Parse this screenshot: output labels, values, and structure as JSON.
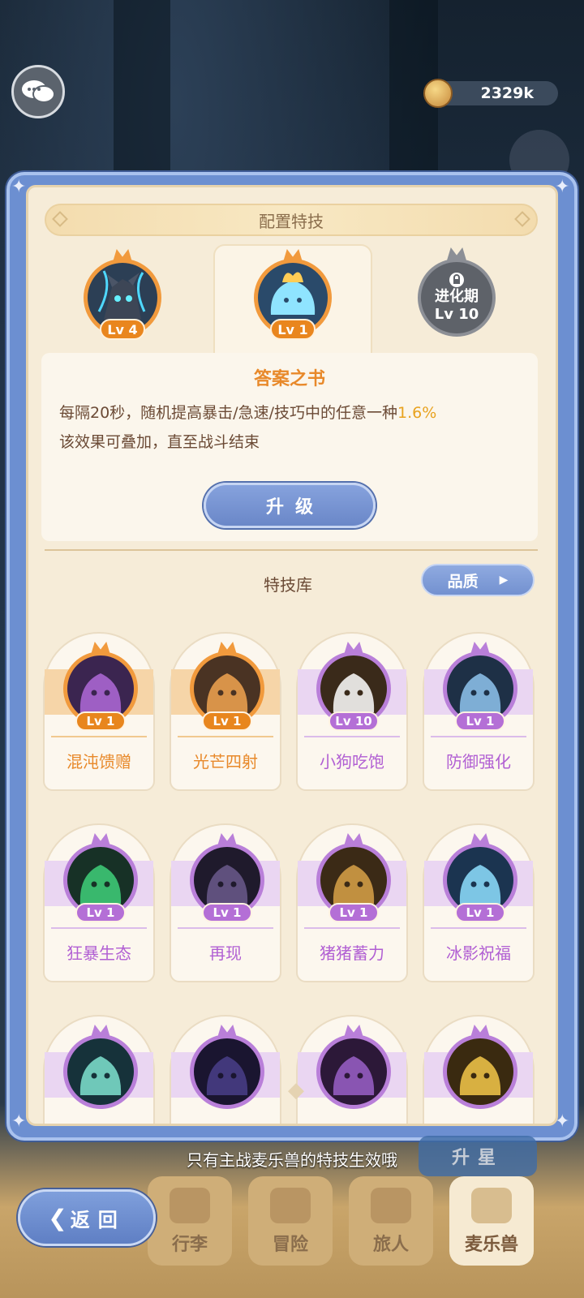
{
  "hud": {
    "coins": "2329k"
  },
  "panel": {
    "title": "配置特技",
    "slots": [
      {
        "level": "Lv 4",
        "color": "#f19a3d",
        "icon": "dark-wolf-icon"
      },
      {
        "level": "Lv 1",
        "color": "#f19a3d",
        "icon": "blue-slime-icon",
        "selected": true
      }
    ],
    "locked_slot": {
      "line1": "进化期",
      "line2": "Lv 10",
      "icon": "lock-icon"
    },
    "selected_skill": {
      "name": "答案之书",
      "desc_prefix": "每隔20秒，随机提高暴击/急速/技巧中的任意一种",
      "desc_highlight": "1.6%",
      "desc_line2": "该效果可叠加，直至战斗结束"
    },
    "upgrade_button": "升级",
    "library_title": "特技库",
    "quality_button": "品质"
  },
  "skills": [
    {
      "name": "混沌馈赠",
      "level": "Lv 1",
      "tier": "orange",
      "icon": "purple-flame-icon"
    },
    {
      "name": "光芒四射",
      "level": "Lv 1",
      "tier": "orange",
      "icon": "calico-cat-icon"
    },
    {
      "name": "小狗吃饱",
      "level": "Lv 10",
      "tier": "purple",
      "icon": "white-dog-icon"
    },
    {
      "name": "防御强化",
      "level": "Lv 1",
      "tier": "purple",
      "icon": "ice-shark-icon"
    },
    {
      "name": "狂暴生态",
      "level": "Lv 1",
      "tier": "purple",
      "icon": "green-sprout-icon"
    },
    {
      "name": "再现",
      "level": "Lv 1",
      "tier": "purple",
      "icon": "shadow-cat-icon"
    },
    {
      "name": "猪猪蓄力",
      "level": "Lv 1",
      "tier": "purple",
      "icon": "golden-pig-icon"
    },
    {
      "name": "冰影祝福",
      "level": "Lv 1",
      "tier": "purple",
      "icon": "ice-spirit-icon"
    },
    {
      "name": "",
      "level": "",
      "tier": "purple",
      "icon": "teal-ghost-icon"
    },
    {
      "name": "",
      "level": "",
      "tier": "purple",
      "icon": "dark-dragon-icon"
    },
    {
      "name": "",
      "level": "",
      "tier": "purple",
      "icon": "purple-blob-icon"
    },
    {
      "name": "",
      "level": "",
      "tier": "purple",
      "icon": "gold-flame-icon"
    }
  ],
  "footer": {
    "hint": "只有主战麦乐兽的特技生效哦",
    "star_up_button": "升星",
    "back_button": "返回",
    "nav": [
      "行李",
      "冒险",
      "旅人",
      "麦乐兽"
    ]
  },
  "colors": {
    "orange_tier": "#f19a3d",
    "purple_tier": "#b97fd9",
    "accent_blue": "#6c8fd1",
    "highlight": "#e8a21e"
  }
}
